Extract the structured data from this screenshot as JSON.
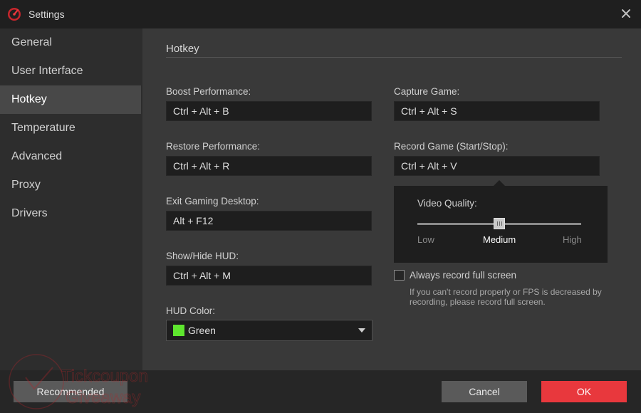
{
  "window": {
    "title": "Settings",
    "icons": {
      "logo": "app-logo-icon",
      "close": "close-icon"
    }
  },
  "sidebar": {
    "items": [
      {
        "label": "General",
        "active": false
      },
      {
        "label": "User Interface",
        "active": false
      },
      {
        "label": "Hotkey",
        "active": true
      },
      {
        "label": "Temperature",
        "active": false
      },
      {
        "label": "Advanced",
        "active": false
      },
      {
        "label": "Proxy",
        "active": false
      },
      {
        "label": "Drivers",
        "active": false
      }
    ]
  },
  "content": {
    "section_title": "Hotkey",
    "hotkeys_left": [
      {
        "label": "Boost Performance:",
        "value": "Ctrl + Alt + B"
      },
      {
        "label": "Restore Performance:",
        "value": "Ctrl + Alt + R"
      },
      {
        "label": "Exit Gaming Desktop:",
        "value": "Alt + F12"
      },
      {
        "label": "Show/Hide HUD:",
        "value": "Ctrl + Alt + M"
      }
    ],
    "hotkeys_right": [
      {
        "label": "Capture Game:",
        "value": "Ctrl + Alt + S"
      },
      {
        "label": "Record Game (Start/Stop):",
        "value": "Ctrl + Alt + V"
      }
    ],
    "hud_color": {
      "label": "HUD Color:",
      "value": "Green",
      "swatch_color": "#5ee62e",
      "icon": "chevron-down-icon"
    },
    "video_quality": {
      "label": "Video Quality:",
      "options": [
        "Low",
        "Medium",
        "High"
      ],
      "selected": "Medium",
      "level": 0.5
    },
    "full_screen": {
      "label": "Always record full screen",
      "checked": false,
      "hint": "If you can't record properly or FPS is decreased by recording, please record full screen."
    }
  },
  "footer": {
    "recommended_label": "Recommended",
    "cancel_label": "Cancel",
    "ok_label": "OK"
  },
  "watermark": {
    "line1": "Tickcoupon",
    "line2": "Giveaway"
  },
  "colors": {
    "accent": "#e8383d",
    "nav_active_bg": "#484848",
    "field_bg": "#1e1e1e"
  }
}
